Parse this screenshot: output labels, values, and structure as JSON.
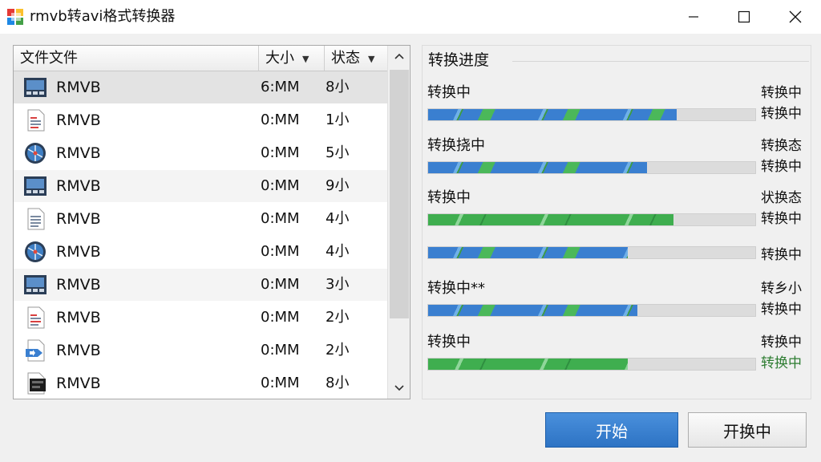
{
  "window": {
    "title": "rmvb转avi格式转换器"
  },
  "file_list": {
    "columns": {
      "name": "文件文件",
      "size": "大小",
      "status": "状态"
    },
    "rows": [
      {
        "icon": "video-icon",
        "name": "RMVB",
        "size": "6:MM",
        "status": "8小"
      },
      {
        "icon": "document-icon",
        "name": "RMVB",
        "size": "0:MM",
        "status": "1小"
      },
      {
        "icon": "media-disc-icon",
        "name": "RMVB",
        "size": "0:MM",
        "status": "5小"
      },
      {
        "icon": "video-icon",
        "name": "RMVB",
        "size": "0:MM",
        "status": "9小"
      },
      {
        "icon": "document-icon",
        "name": "RMVB",
        "size": "0:MM",
        "status": "4小"
      },
      {
        "icon": "media-disc-icon",
        "name": "RMVB",
        "size": "0:MM",
        "status": "4小"
      },
      {
        "icon": "video-icon",
        "name": "RMVB",
        "size": "0:MM",
        "status": "3小"
      },
      {
        "icon": "document-icon",
        "name": "RMVB",
        "size": "0:MM",
        "status": "2小"
      },
      {
        "icon": "convert-file-icon",
        "name": "RMVB",
        "size": "0:MM",
        "status": "2小"
      },
      {
        "icon": "film-file-icon",
        "name": "RMVB",
        "size": "0:MM",
        "status": "8小"
      }
    ]
  },
  "progress": {
    "title": "转换进度",
    "tasks": [
      {
        "label": "转换中",
        "right1": "转换中",
        "right2": "转换中",
        "progress": 0.76,
        "color": "blue"
      },
      {
        "label": "转换挠中",
        "right1": "转换态",
        "right2": "转换中",
        "progress": 0.67,
        "color": "blue"
      },
      {
        "label": "转换中",
        "right1": "状换态",
        "right2": "转换中",
        "progress": 0.75,
        "color": "green"
      },
      {
        "label": "",
        "right1": "",
        "right2": "转换中",
        "progress": 0.61,
        "color": "blue"
      },
      {
        "label": "转换中**",
        "right1": "转乡小",
        "right2": "转换中",
        "progress": 0.64,
        "color": "blue"
      },
      {
        "label": "转换中",
        "right1": "转换中",
        "right2": "转换中",
        "progress": 0.61,
        "color": "green",
        "right2_color": "#2e7d32"
      }
    ]
  },
  "buttons": {
    "start": "开始",
    "stop": "开换中"
  },
  "colors": {
    "accent_blue": "#2d73c4",
    "progress_blue": "#3a7fd0",
    "progress_green": "#3fae4f"
  }
}
